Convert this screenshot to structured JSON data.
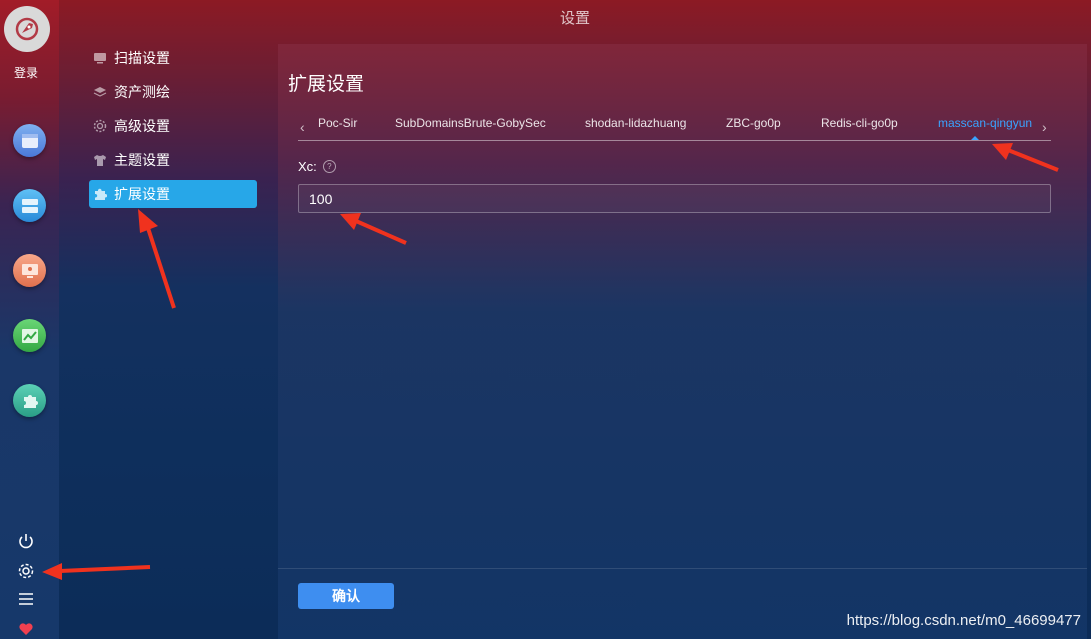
{
  "window": {
    "title": "设置"
  },
  "sidebar": {
    "login_label": "登录",
    "apps": [
      {
        "icon": "window-icon",
        "color": "#5b8be0"
      },
      {
        "icon": "server-icon",
        "color": "#3c9ae0"
      },
      {
        "icon": "monitor-icon",
        "color": "#f08a6a"
      },
      {
        "icon": "chart-icon",
        "color": "#4cc25a"
      },
      {
        "icon": "puzzle-icon",
        "color": "#3ab69a"
      }
    ],
    "bottom": [
      "power-icon",
      "settings-icon",
      "menu-icon",
      "heart-icon"
    ]
  },
  "settings_menu": {
    "items": [
      {
        "label": "扫描设置",
        "icon": "scan-icon"
      },
      {
        "label": "资产测绘",
        "icon": "layers-icon"
      },
      {
        "label": "高级设置",
        "icon": "gear-icon"
      },
      {
        "label": "主题设置",
        "icon": "shirt-icon"
      },
      {
        "label": "扩展设置",
        "icon": "puzzle-icon",
        "active": true
      }
    ]
  },
  "panel": {
    "title": "扩展设置",
    "tabs": [
      {
        "label": "Poc-Sir"
      },
      {
        "label": "SubDomainsBrute-GobySec"
      },
      {
        "label": "shodan-lidazhuang"
      },
      {
        "label": "ZBC-go0p"
      },
      {
        "label": "Redis-cli-go0p"
      },
      {
        "label": "masscan-qingyun",
        "active": true
      }
    ],
    "field": {
      "label": "Xc:",
      "value": "100"
    },
    "confirm_label": "确认"
  },
  "watermark": "https://blog.csdn.net/m0_46699477",
  "colors": {
    "accent": "#27a7e8",
    "tab_active": "#3aa3ff",
    "button": "#3e8ef0",
    "annotation_arrow": "#f0321e"
  }
}
